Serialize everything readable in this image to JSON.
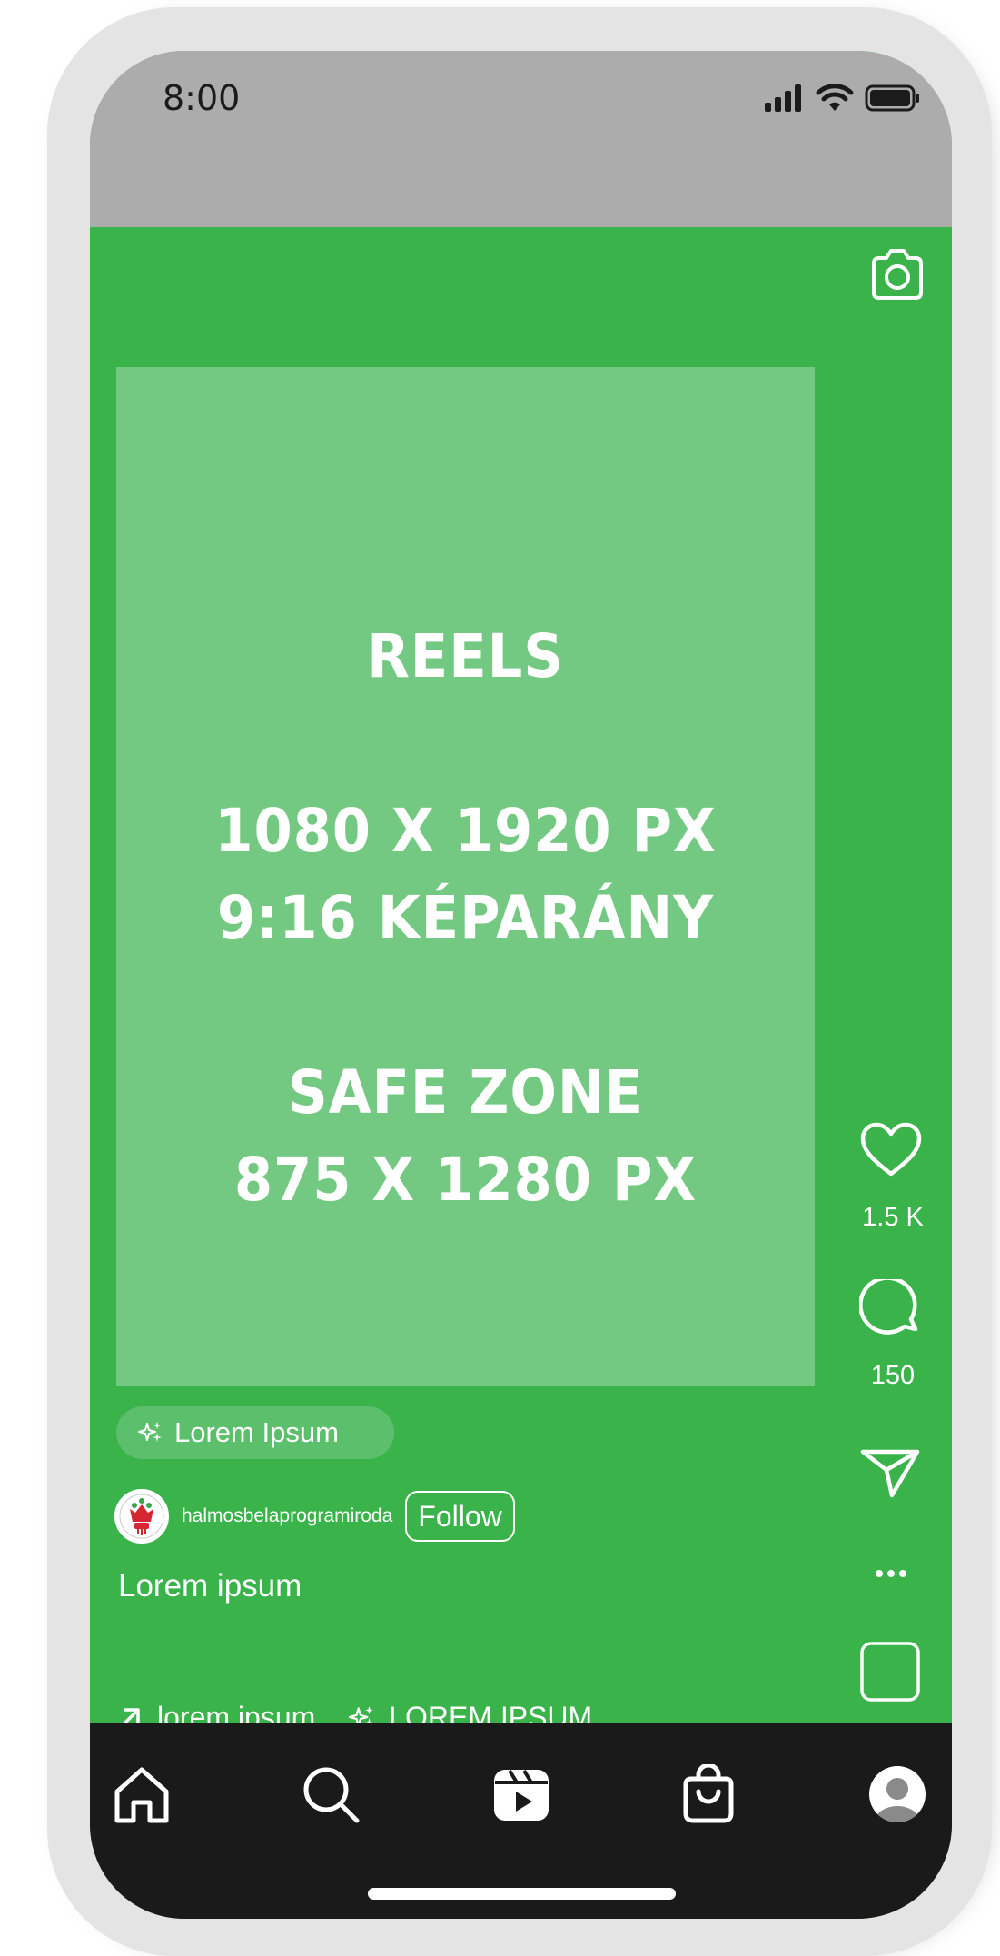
{
  "status_bar": {
    "time": "8:00",
    "icons": [
      "cellular-signal-icon",
      "wifi-icon",
      "battery-icon"
    ]
  },
  "top": {
    "camera_icon": "camera-icon"
  },
  "safe_zone": {
    "line1": "REELS",
    "line2": "1080 X 1920 PX",
    "line3": "9:16 KÉPARÁNY",
    "line4": "SAFE ZONE",
    "line5": "875 X 1280 PX"
  },
  "post": {
    "pill_label": "Lorem Ipsum",
    "username": "halmosbelaprogramiroda",
    "follow_label": "Follow",
    "caption": "Lorem ipsum",
    "audio_text": "lorem ipsum.",
    "effect_text": "LOREM IPSUM"
  },
  "actions": {
    "likes": "1.5 K",
    "comments": "150"
  },
  "nav": {
    "items": [
      "home-icon",
      "search-icon",
      "reels-icon",
      "shop-icon",
      "profile-icon"
    ]
  },
  "colors": {
    "background_green": "#39b34a",
    "safe_zone_green": "#74c982",
    "status_bar_gray": "#acacac",
    "nav_dark": "#1a1a1a",
    "phone_frame": "#e4e4e4"
  }
}
